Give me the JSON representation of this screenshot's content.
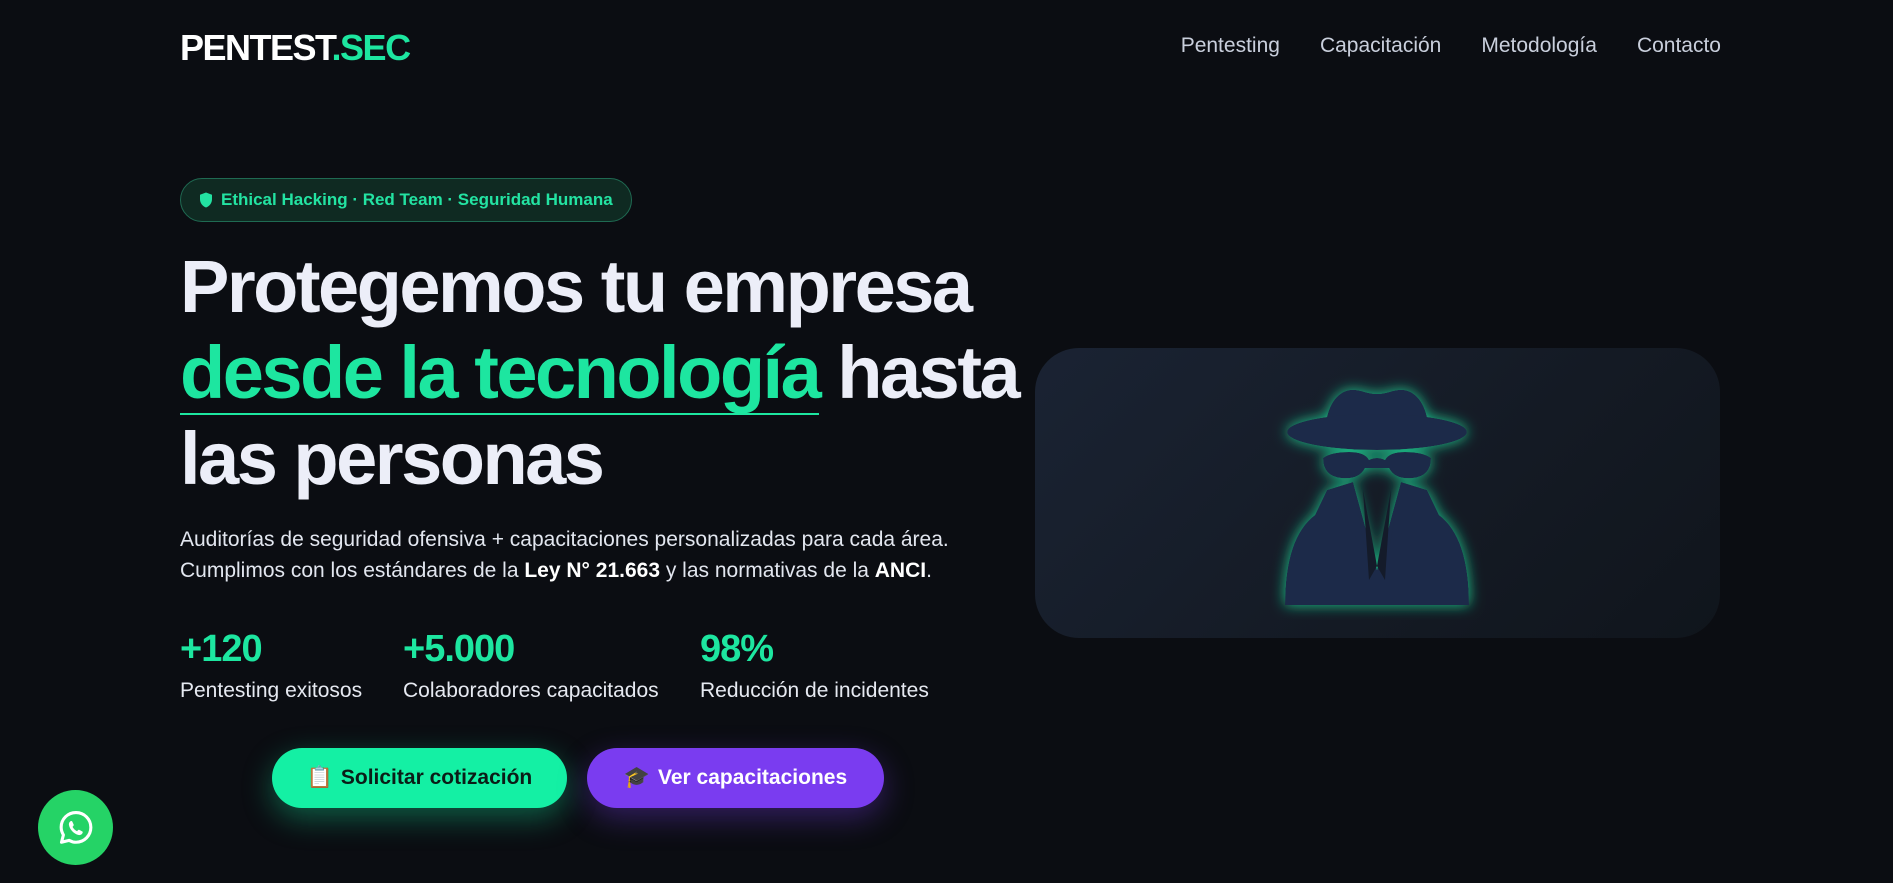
{
  "brand": {
    "logo_main": "PENTEST",
    "logo_accent": ".SEC",
    "accent_color": "#1de6a0"
  },
  "nav": {
    "items": [
      "Pentesting",
      "Capacitación",
      "Metodología",
      "Contacto"
    ]
  },
  "badge": {
    "icon": "shield-icon",
    "text": "Ethical Hacking · Red Team · Seguridad Humana"
  },
  "headline": {
    "line1": "Protegemos tu empresa",
    "highlight": "desde la tecnología",
    "line2_rest": " hasta",
    "line3": "las personas"
  },
  "description": {
    "line1": "Auditorías de seguridad ofensiva + capacitaciones personalizadas para cada área.",
    "line2_a": "Cumplimos con los estándares de la ",
    "law": "Ley N° 21.663",
    "line2_b": " y las normativas de la ",
    "agency": "ANCI",
    "line2_c": "."
  },
  "stats": [
    {
      "value": "+120",
      "label": "Pentesting exitosos"
    },
    {
      "value": "+5.000",
      "label": "Colaboradores capacitados"
    },
    {
      "value": "98%",
      "label": "Reducción de incidentes"
    }
  ],
  "buttons": {
    "quote": {
      "icon": "clipboard-icon",
      "emoji": "📋",
      "label": "Solicitar cotización",
      "color": "#14f0a4"
    },
    "training": {
      "icon": "graduation-cap-icon",
      "emoji": "🎓",
      "label": "Ver capacitaciones",
      "color": "#7a3cf0"
    }
  },
  "hero": {
    "icon": "spy-agent-icon"
  },
  "whatsapp": {
    "icon": "whatsapp-icon",
    "color": "#25d366"
  }
}
